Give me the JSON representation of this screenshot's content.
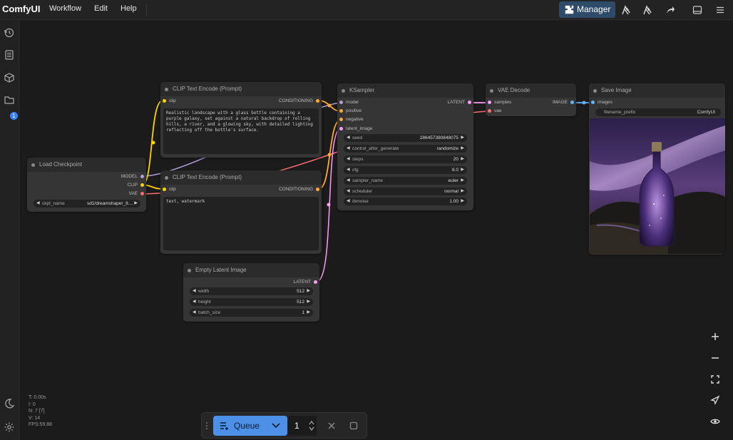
{
  "app": {
    "name": "ComfyUI",
    "menus": [
      "Workflow",
      "Edit",
      "Help"
    ],
    "manager_label": "Manager"
  },
  "nodes": {
    "load_checkpoint": {
      "title": "Load Checkpoint",
      "outputs": [
        "MODEL",
        "CLIP",
        "VAE"
      ],
      "ckpt_label": "ckpt_name",
      "ckpt_value": "sd1/dreamshaper_8...."
    },
    "clip_pos": {
      "title": "CLIP Text Encode (Prompt)",
      "input": "clip",
      "output": "CONDITIONING",
      "text": "Realistic landscape with a glass bottle containing a purple galaxy, set against a natural backdrop of rolling hills, a river, and a glowing sky, with detailed lighting reflecting off the bottle's surface."
    },
    "clip_neg": {
      "title": "CLIP Text Encode (Prompt)",
      "input": "clip",
      "output": "CONDITIONING",
      "text": "text, watermark"
    },
    "ksampler": {
      "title": "KSampler",
      "inputs": [
        "model",
        "positive",
        "negative",
        "latent_image"
      ],
      "output": "LATENT",
      "widgets": [
        {
          "label": "seed",
          "value": "286457380848075"
        },
        {
          "label": "control_after_generate",
          "value": "randomize"
        },
        {
          "label": "steps",
          "value": "20"
        },
        {
          "label": "cfg",
          "value": "8.0"
        },
        {
          "label": "sampler_name",
          "value": "euler"
        },
        {
          "label": "scheduler",
          "value": "normal"
        },
        {
          "label": "denoise",
          "value": "1.00"
        }
      ]
    },
    "vae_decode": {
      "title": "VAE Decode",
      "inputs": [
        "samples",
        "vae"
      ],
      "output": "IMAGE"
    },
    "save_image": {
      "title": "Save Image",
      "input": "images",
      "prefix_label": "filename_prefix",
      "prefix_value": "ComfyUI"
    },
    "empty_latent": {
      "title": "Empty Latent Image",
      "output": "LATENT",
      "widgets": [
        {
          "label": "width",
          "value": "512"
        },
        {
          "label": "height",
          "value": "512"
        },
        {
          "label": "batch_size",
          "value": "1"
        }
      ]
    }
  },
  "stats": [
    "T: 0.00s",
    "I: 0",
    "N: 7 [7]",
    "V: 14",
    "FPS:59.88"
  ],
  "queue": {
    "label": "Queue",
    "count": "1"
  },
  "sidebar_badge": "1",
  "colors": {
    "accent": "#3b82f6",
    "model_link": "#b39ddb",
    "clip_link": "#ffd500",
    "vae_link": "#ff6e6e",
    "conditioning_link": "#ffa931",
    "latent_link": "#ff9cf9",
    "image_link": "#64b5f6"
  }
}
